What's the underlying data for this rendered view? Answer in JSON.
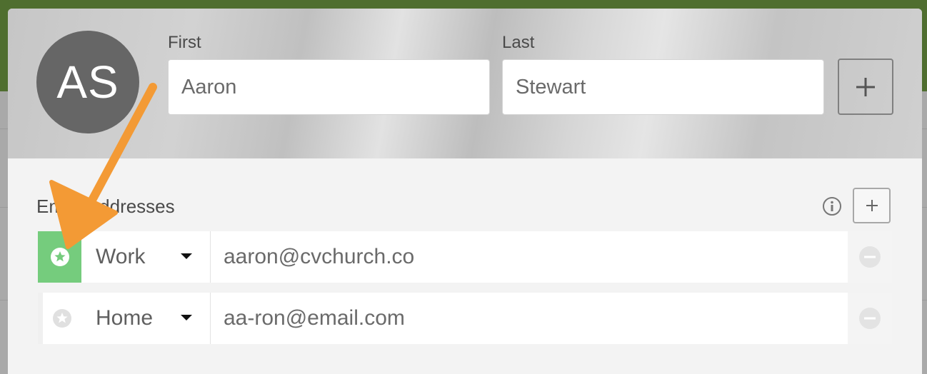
{
  "contact": {
    "initials": "AS",
    "first_label": "First",
    "first_value": "Aaron",
    "last_label": "Last",
    "last_value": "Stewart"
  },
  "emails": {
    "section_title": "Email Addresses",
    "rows": [
      {
        "type": "Work",
        "address": "aaron@cvchurch.co",
        "primary": true
      },
      {
        "type": "Home",
        "address": "aa-ron@email.com",
        "primary": false
      }
    ]
  },
  "icons": {
    "add_name": "plus-icon",
    "info": "info-icon",
    "add_email": "plus-icon",
    "primary_star": "star-icon",
    "dropdown": "caret-down-icon",
    "remove": "minus-circle-icon",
    "annotation": "arrow-annotation"
  },
  "colors": {
    "primary_green": "#75cc7d",
    "avatar_bg": "#666666",
    "annotation_orange": "#f39a35"
  }
}
